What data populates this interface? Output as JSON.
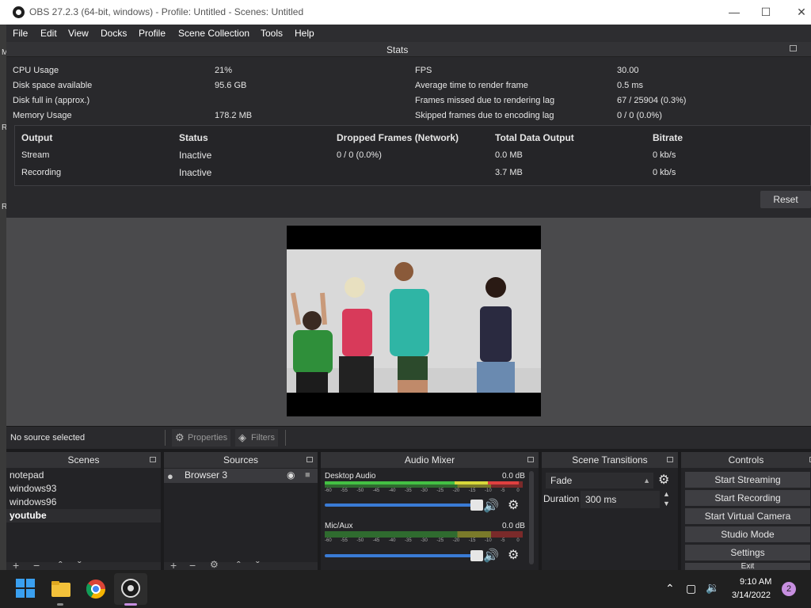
{
  "window": {
    "title": "OBS 27.2.3 (64-bit, windows) - Profile: Untitled - Scenes: Untitled"
  },
  "menu": [
    "File",
    "Edit",
    "View",
    "Docks",
    "Profile",
    "Scene Collection",
    "Tools",
    "Help"
  ],
  "stats": {
    "title": "Stats",
    "left": [
      {
        "label": "CPU Usage",
        "value": "21%"
      },
      {
        "label": "Disk space available",
        "value": "95.6 GB"
      },
      {
        "label": "Disk full in (approx.)",
        "value": ""
      },
      {
        "label": "Memory Usage",
        "value": "178.2 MB"
      }
    ],
    "right": [
      {
        "label": "FPS",
        "value": "30.00"
      },
      {
        "label": "Average time to render frame",
        "value": "0.5 ms"
      },
      {
        "label": "Frames missed due to rendering lag",
        "value": "67 / 25904 (0.3%)"
      },
      {
        "label": "Skipped frames due to encoding lag",
        "value": "0 / 0 (0.0%)"
      }
    ],
    "table": {
      "headers": [
        "Output",
        "Status",
        "Dropped Frames (Network)",
        "Total Data Output",
        "Bitrate"
      ],
      "rows": [
        [
          "Stream",
          "Inactive",
          "0 / 0 (0.0%)",
          "0.0 MB",
          "0 kb/s"
        ],
        [
          "Recording",
          "Inactive",
          "",
          "3.7 MB",
          "0 kb/s"
        ]
      ]
    },
    "reset_label": "Reset"
  },
  "source_bar": {
    "status": "No source selected",
    "properties_label": "Properties",
    "filters_label": "Filters"
  },
  "scenes": {
    "title": "Scenes",
    "items": [
      "notepad",
      "windows93",
      "windows96",
      "youtube"
    ],
    "selected": "youtube"
  },
  "sources": {
    "title": "Sources",
    "items": [
      "Browser 3"
    ]
  },
  "mixer": {
    "title": "Audio Mixer",
    "channels": [
      {
        "name": "Desktop Audio",
        "db": "0.0 dB",
        "level": 0.98
      },
      {
        "name": "Mic/Aux",
        "db": "0.0 dB",
        "level": 0.0
      }
    ],
    "ticks": [
      "-60",
      "-55",
      "-50",
      "-45",
      "-40",
      "-35",
      "-30",
      "-25",
      "-20",
      "-15",
      "-10",
      "-5",
      "0"
    ]
  },
  "transitions": {
    "title": "Scene Transitions",
    "selected": "Fade",
    "duration_label": "Duration",
    "duration_value": "300 ms"
  },
  "controls": {
    "title": "Controls",
    "buttons": [
      "Start Streaming",
      "Start Recording",
      "Start Virtual Camera",
      "Studio Mode",
      "Settings",
      "Exit"
    ]
  },
  "taskbar": {
    "time": "9:10 AM",
    "date": "3/14/2022",
    "notifications": "2"
  },
  "colors": {
    "accent": "#3a7bd5",
    "panel": "#232326",
    "header": "#333336"
  }
}
